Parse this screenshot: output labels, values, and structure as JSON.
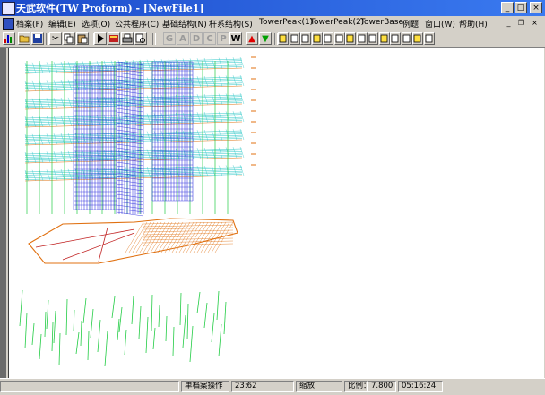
{
  "window": {
    "title": "天武软件(TW Proform) - [NewFile1]"
  },
  "caption_buttons": {
    "minimize": "_",
    "maximize": "□",
    "close": "×"
  },
  "menu": {
    "items": [
      "档案(F)",
      "编辑(E)",
      "选项(O)",
      "公共程序(C)",
      "基础结构(N)",
      "杆系结构(S)",
      "TowerPeak(1)",
      "TowerPeak(2)",
      "TowerBase",
      "例题",
      "窗口(W)",
      "帮助(H)"
    ]
  },
  "mdi_controls": {
    "minimize": "_",
    "restore": "❐",
    "close": "×"
  },
  "toolbar": {
    "icons": [
      "chart-icon",
      "open-folder-icon",
      "save-icon",
      "cut-icon",
      "copy-icon",
      "paste-icon",
      "run-icon",
      "book-icon",
      "print-icon",
      "print-preview-icon"
    ],
    "letters": [
      "G",
      "A",
      "D",
      "C",
      "P",
      "W"
    ],
    "arrows": [
      "▲",
      "▼"
    ],
    "tools": [
      "tool-1",
      "tool-2",
      "tool-3",
      "tool-4",
      "tool-5",
      "tool-6",
      "tool-7",
      "tool-8",
      "tool-9",
      "tool-10",
      "tool-11",
      "tool-12",
      "tool-13",
      "tool-14"
    ]
  },
  "status": {
    "mode": "单档案操作",
    "coords": "23:62",
    "zoom_label": "缩放",
    "scale_label": "比例：",
    "scale_value": "7.800",
    "time": "05:16:24"
  },
  "colors": {
    "wire_green": "#22cc44",
    "wire_blue": "#1a1adb",
    "wire_orange": "#e07010",
    "wire_cyan": "#30c8c8"
  }
}
